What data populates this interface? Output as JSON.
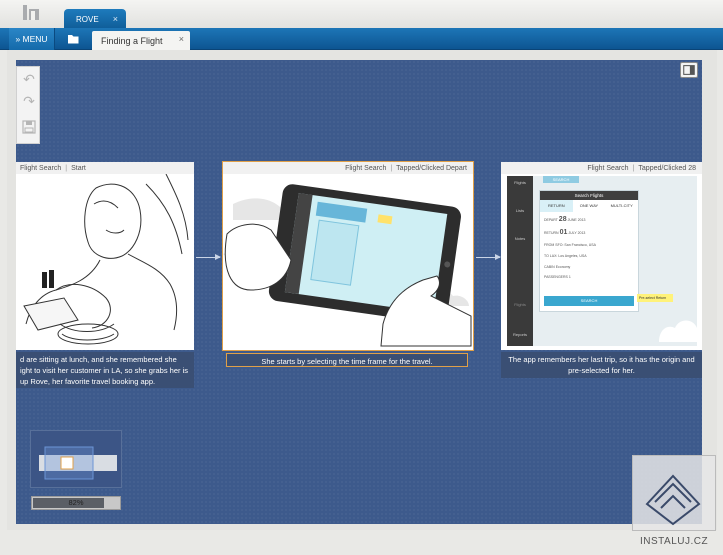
{
  "app": {
    "logo_label": "in"
  },
  "tabs": {
    "project": "ROVE",
    "page": "Finding a Flight",
    "close_glyph": "×"
  },
  "toolbar": {
    "menu_label": "» MENU"
  },
  "frames": [
    {
      "screen": "Flight Search",
      "state": "Start",
      "caption": "d are sitting at lunch, and she remembered she ight to visit her customer in LA, so she grabs her is up Rove, her favorite travel booking app."
    },
    {
      "screen": "Flight Search",
      "state": "Tapped/Clicked Depart",
      "caption": "She starts by selecting the time frame for the travel."
    },
    {
      "screen": "Flight Search",
      "state": "Tapped/Clicked 28",
      "caption": "The app remembers her last trip, so it has the origin and pre-selected for her."
    }
  ],
  "app_screen": {
    "nav_items": [
      "Flights",
      "Lists",
      "Notes",
      "Flights",
      "Reports"
    ],
    "search_button": "SEARCH",
    "panel_title": "Search Flights",
    "trip_types": [
      "RETURN",
      "ONE WAY",
      "MULTI-CITY"
    ],
    "fields": [
      {
        "label": "DEPART",
        "value": "28",
        "sub": "JUNE 2013"
      },
      {
        "label": "RETURN",
        "value": "01",
        "sub": "JULY 2013"
      },
      {
        "label": "FROM",
        "value": "SFO: San Francisco, USA"
      },
      {
        "label": "TO",
        "value": "LAX: Los Angeles, USA"
      },
      {
        "label": "CABIN",
        "value": "Economy"
      },
      {
        "label": "PASSENGERS",
        "value": "1"
      }
    ],
    "submit": "SEARCH",
    "sticky_note": "Pre-select Return"
  },
  "zoom": {
    "label": "82%",
    "value_percent": 82
  },
  "watermark": {
    "label": "INSTALUJ.CZ"
  },
  "colors": {
    "accent": "#1565a6",
    "canvas": "#3d5a8c",
    "selection": "#e0a048"
  }
}
